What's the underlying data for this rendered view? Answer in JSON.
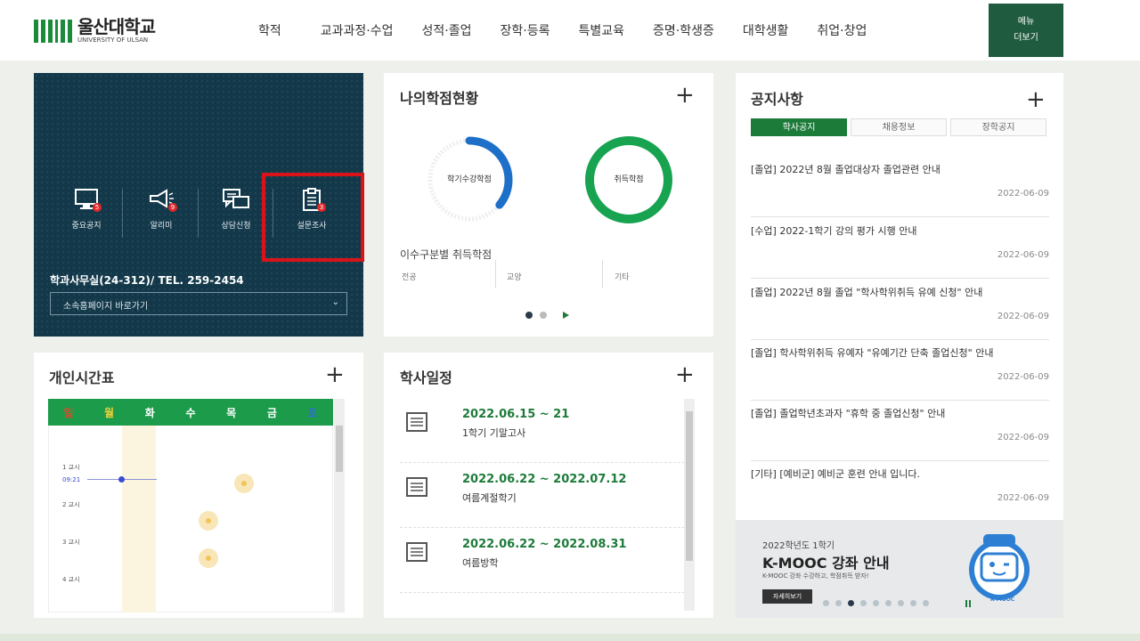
{
  "header": {
    "logo_kr": "울산대학교",
    "logo_en": "UNIVERSITY OF ULSAN",
    "nav": [
      "학적",
      "교과과정·수업",
      "성적·졸업",
      "장학·등록",
      "특별교육",
      "증명·학생증",
      "대학생활",
      "취업·창업"
    ],
    "menu_more_line1": "메뉴",
    "menu_more_line2": "더보기"
  },
  "quick_menu": {
    "items": [
      {
        "label": "중요공지",
        "icon": "monitor-icon",
        "badge": "5"
      },
      {
        "label": "알리미",
        "icon": "megaphone-icon",
        "badge": "9"
      },
      {
        "label": "상담신청",
        "icon": "chat-icon",
        "badge": ""
      },
      {
        "label": "설문조사",
        "icon": "clipboard-icon",
        "badge": "3"
      }
    ],
    "office": "학과사무실(24-312)/ TEL. 259-2454",
    "site_select": "소속홈페이지 바로가기"
  },
  "credits": {
    "title": "나의학점현황",
    "ring1_label": "학기수강학점",
    "ring1_progress": 0.36,
    "ring2_label": "취득학점",
    "ring2_progress": 1.0,
    "by_type_title": "이수구분별 취득학점",
    "columns": [
      "전공",
      "교양",
      "기타"
    ]
  },
  "notices": {
    "title": "공지사항",
    "tabs": [
      "학사공지",
      "채용정보",
      "장학공지"
    ],
    "active_tab": "학사공지",
    "items": [
      {
        "title": "[졸업] 2022년 8월 졸업대상자 졸업관련 안내",
        "date": "2022-06-09"
      },
      {
        "title": "[수업] 2022-1학기 강의 평가 시행 안내",
        "date": "2022-06-09"
      },
      {
        "title": "[졸업] 2022년 8월 졸업 \"학사학위취득 유예 신청\" 안내",
        "date": "2022-06-09"
      },
      {
        "title": "[졸업] 학사학위취득 유예자 \"유예기간 단축 졸업신청\" 안내",
        "date": "2022-06-09"
      },
      {
        "title": "[졸업] 졸업학년초과자 \"휴학 중 졸업신청\" 안내",
        "date": "2022-06-09"
      },
      {
        "title": "[기타] [예비군] 예비군 훈련 안내 입니다.",
        "date": "2022-06-09"
      }
    ]
  },
  "kmooc": {
    "subtitle": "2022학년도 1학기",
    "title": "K-MOOC 강좌 안내",
    "desc": "K-MOOC 강좌 수강하고, 학점취득 받자!",
    "more": "자세히보기",
    "logo_text": "K-MOOC"
  },
  "timetable": {
    "title": "개인시간표",
    "days": [
      "일",
      "월",
      "화",
      "수",
      "목",
      "금",
      "토"
    ],
    "periods": [
      "1 교시",
      "2 교시",
      "3 교시",
      "4 교시"
    ],
    "now_label": "09:21"
  },
  "schedule": {
    "title": "학사일정",
    "items": [
      {
        "date": "2022.06.15 ~ 21",
        "name": "1학기 기말고사"
      },
      {
        "date": "2022.06.22 ~ 2022.07.12",
        "name": "여름계절학기"
      },
      {
        "date": "2022.06.22 ~ 2022.08.31",
        "name": "여름방학"
      }
    ]
  },
  "colors": {
    "brand_green": "#1d7b3a",
    "dark_panel": "#12384a",
    "highlight_red": "#d8141a",
    "ring_blue": "#1e6fc8",
    "ring_green": "#17a350"
  }
}
